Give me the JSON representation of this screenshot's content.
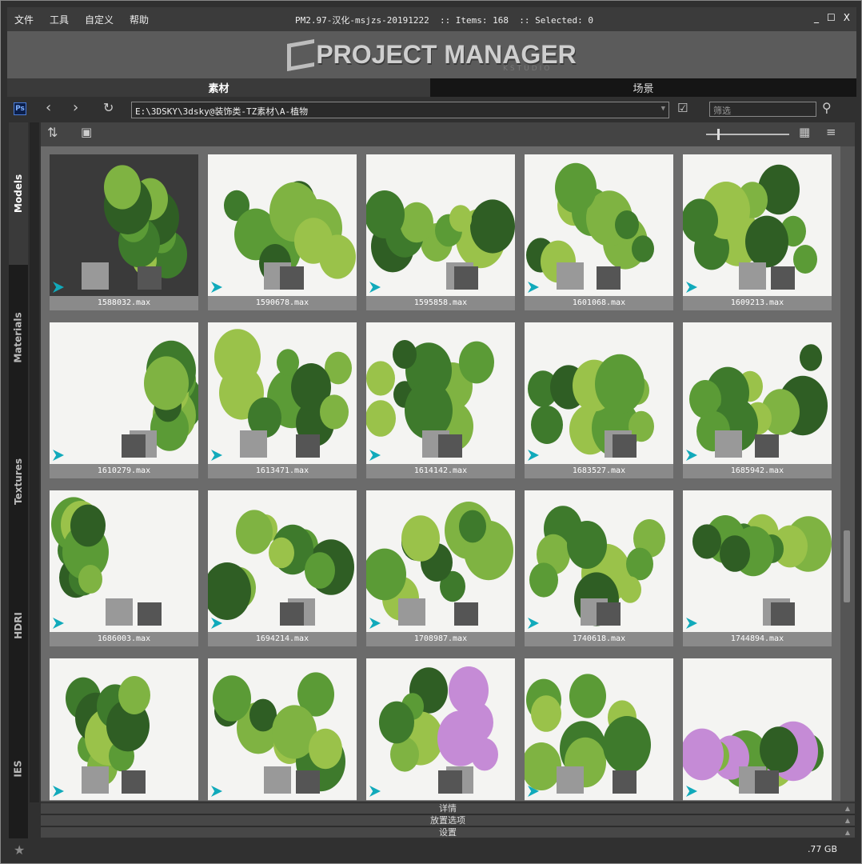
{
  "window": {
    "menu": [
      "文件",
      "工具",
      "自定义",
      "帮助"
    ],
    "title": "PM2.97-汉化-msjzs-20191222  :: Items: 168  :: Selected: 0",
    "controls": [
      "_",
      "☐",
      "X"
    ]
  },
  "logo": {
    "text": "PROJECT MANAGER",
    "sub": "KSTUDIO"
  },
  "tabs": [
    "素材",
    "场景"
  ],
  "toolbar": {
    "ps_label": "Ps",
    "path": "E:\\3DSKY\\3dsky@装饰类-TZ素材\\A-植物",
    "filter_placeholder": "筛选"
  },
  "sidebar": [
    "Models",
    "Materials",
    "Textures",
    "HDRI",
    "IES"
  ],
  "items": [
    "1588032.max",
    "1590678.max",
    "1595858.max",
    "1601068.max",
    "1609213.max",
    "1610279.max",
    "1613471.max",
    "1614142.max",
    "1683527.max",
    "1685942.max",
    "1686003.max",
    "1694214.max",
    "1708987.max",
    "1740618.max",
    "1744894.max",
    "",
    "",
    "",
    "",
    ""
  ],
  "panels": [
    "详情",
    "放置选项",
    "设置"
  ],
  "status": {
    "size": ".77 GB"
  },
  "colors": {
    "accent": "#11aabb",
    "thumb_dark": "#3a3a3a"
  }
}
